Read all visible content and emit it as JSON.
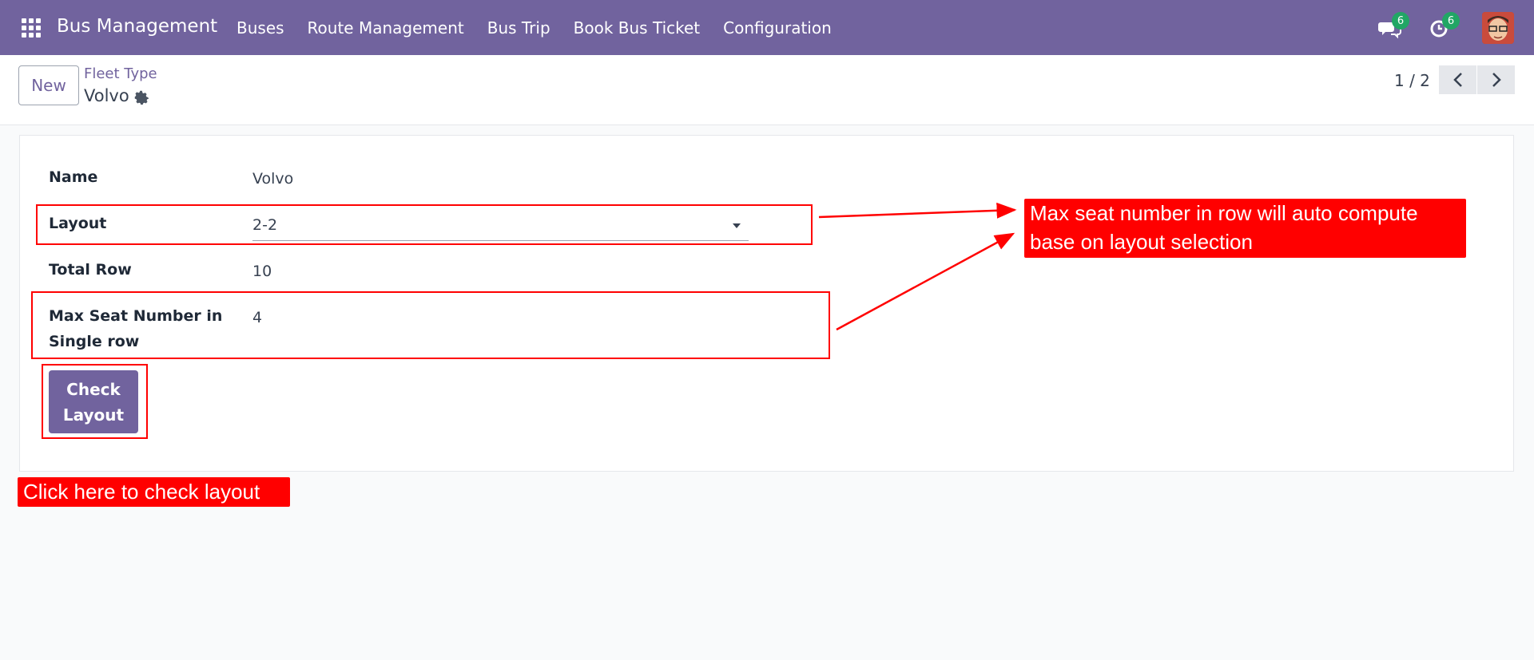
{
  "navbar": {
    "app_title": "Bus Management",
    "menu": [
      "Buses",
      "Route Management",
      "Bus Trip",
      "Book Bus Ticket",
      "Configuration"
    ],
    "messages_count": "6",
    "activities_count": "6"
  },
  "control_panel": {
    "new_label": "New",
    "breadcrumb": "Fleet Type",
    "record_title": "Volvo",
    "pager": "1 / 2"
  },
  "form": {
    "name_label": "Name",
    "name_value": "Volvo",
    "layout_label": "Layout",
    "layout_value": "2-2",
    "total_row_label": "Total Row",
    "total_row_value": "10",
    "max_seat_label_line1": "Max Seat Number in",
    "max_seat_label_line2": "Single row",
    "max_seat_value": "4",
    "check_layout_line1": "Check",
    "check_layout_line2": "Layout"
  },
  "annotations": {
    "auto_compute_line1": "Max seat number in row will auto compute",
    "auto_compute_line2": "base on layout selection",
    "check_layout_note": "Click here to check layout"
  },
  "colors": {
    "primary": "#71639e",
    "badge": "#21a665",
    "annotation": "#ff0000"
  }
}
